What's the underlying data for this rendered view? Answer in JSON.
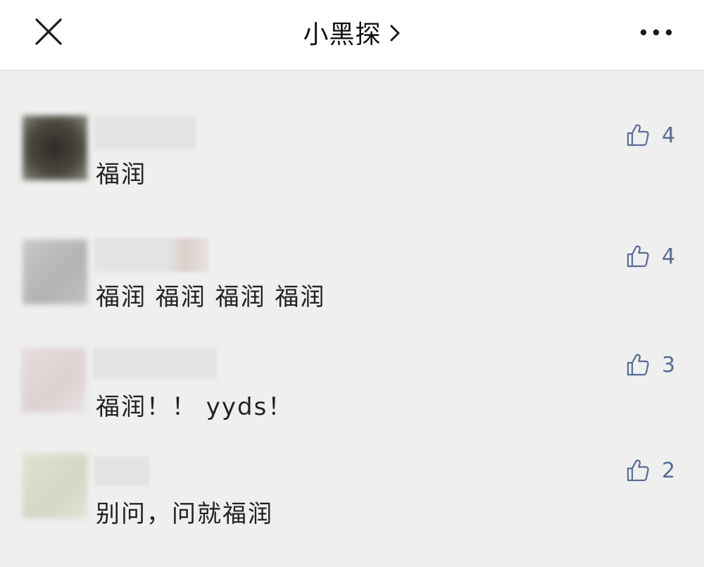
{
  "header": {
    "title": "小黑探",
    "close_icon": "close-icon",
    "more_icon": "more-icon",
    "chevron_icon": "chevron-right-icon"
  },
  "comments": [
    {
      "text": "福润",
      "likes": "4",
      "avatar_color": "#46433c",
      "nickname_hidden": true
    },
    {
      "text": "福润 福润 福润 福润",
      "likes": "4",
      "avatar_color": "#b9b9b9",
      "nickname_hidden": true
    },
    {
      "text": "福润！！ yyds！",
      "likes": "3",
      "avatar_color": "#e3dbdb",
      "nickname_hidden": true
    },
    {
      "text": "别问，问就福润",
      "likes": "2",
      "avatar_color": "#d8dccb",
      "nickname_hidden": true
    }
  ],
  "colors": {
    "background": "#efefef",
    "header_bg": "#ffffff",
    "like_accent": "#586c94"
  }
}
